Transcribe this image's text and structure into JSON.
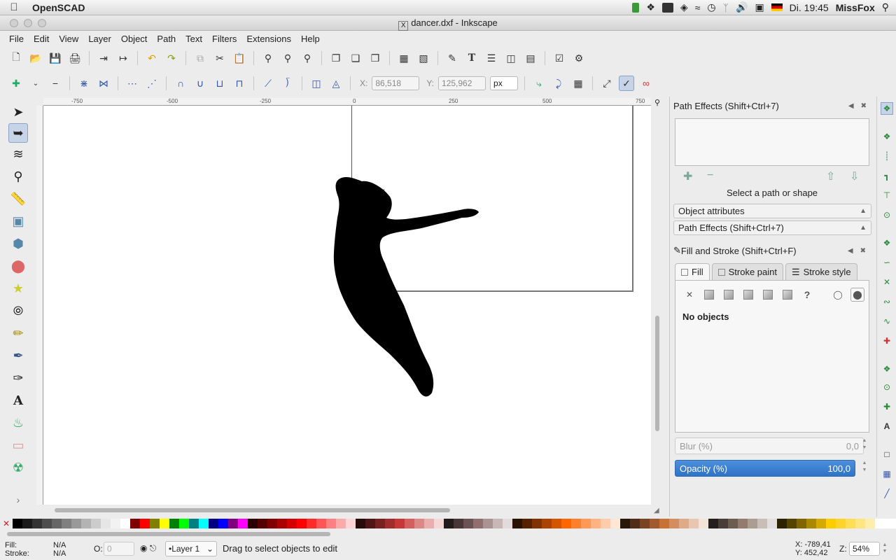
{
  "macbar": {
    "app_name": "OpenSCAD",
    "clock": "Di. 19:45",
    "user": "MissFox"
  },
  "window": {
    "title": "dancer.dxf - Inkscape"
  },
  "menu": [
    "File",
    "Edit",
    "View",
    "Layer",
    "Object",
    "Path",
    "Text",
    "Filters",
    "Extensions",
    "Help"
  ],
  "controls": {
    "x_label": "X:",
    "x_value": "86,518",
    "y_label": "Y:",
    "y_value": "125,962",
    "unit": "px"
  },
  "ruler": {
    "ticks": [
      "-750",
      "-500",
      "-250",
      "0",
      "250",
      "500",
      "750"
    ]
  },
  "dock": {
    "path_effects_title": "Path Effects  (Shift+Ctrl+7)",
    "path_effects_status": "Select a path or shape",
    "object_attributes": "Object attributes",
    "path_effects_collapsed": "Path Effects  (Shift+Ctrl+7)",
    "fill_stroke_title": "Fill and Stroke (Shift+Ctrl+F)",
    "tab_fill": "Fill",
    "tab_stroke_paint": "Stroke paint",
    "tab_stroke_style": "Stroke style",
    "no_objects": "No objects",
    "blur_label": "Blur (%)",
    "blur_value": "0,0",
    "opacity_label": "Opacity (%)",
    "opacity_value": "100,0"
  },
  "status": {
    "fill_label": "Fill:",
    "stroke_label": "Stroke:",
    "fill_value": "N/A",
    "stroke_value": "N/A",
    "o_label": "O:",
    "o_value": "0",
    "layer": "•Layer 1",
    "message": "Drag to select objects to edit",
    "x_coord": "X: -789,41",
    "y_coord": "Y:  452,42",
    "z_label": "Z:",
    "zoom": "54%"
  },
  "palette_colors": [
    "#000000",
    "#1a1a1a",
    "#333333",
    "#4d4d4d",
    "#666666",
    "#808080",
    "#999999",
    "#b3b3b3",
    "#cccccc",
    "#e6e6e6",
    "#f2f2f2",
    "#ffffff",
    "#800000",
    "#ff0000",
    "#808000",
    "#ffff00",
    "#008000",
    "#00ff00",
    "#008080",
    "#00ffff",
    "#000080",
    "#0000ff",
    "#800080",
    "#ff00ff",
    "#2b0000",
    "#550000",
    "#800000",
    "#aa0000",
    "#d40000",
    "#ff0000",
    "#ff2a2a",
    "#ff5555",
    "#ff8080",
    "#ffaaaa",
    "#ffd5d5",
    "#280b0b",
    "#501616",
    "#782121",
    "#a02c2c",
    "#c83737",
    "#d35f5f",
    "#de8787",
    "#e9afaf",
    "#f4d7d7",
    "#241c1c",
    "#483737",
    "#6c5353",
    "#916f6f",
    "#ac9393",
    "#c8b7b7",
    "#e3dbdb",
    "#2b1100",
    "#552200",
    "#803300",
    "#aa4400",
    "#d45500",
    "#ff6600",
    "#ff7f2a",
    "#ff9955",
    "#ffb380",
    "#ffccaa",
    "#ffe6d5",
    "#28170b",
    "#502d16",
    "#784421",
    "#a05a2c",
    "#c87137",
    "#d38d5f",
    "#deaa87",
    "#e9c6af",
    "#f4e3d7",
    "#241f1c",
    "#483e37",
    "#6c5d53",
    "#917c6f",
    "#ac9d93",
    "#c8beb7",
    "#e3dedb",
    "#2b2200",
    "#554400",
    "#806600",
    "#aa8800",
    "#d4aa00",
    "#ffcc00",
    "#ffd42a",
    "#ffdd55",
    "#ffe680",
    "#ffeeaa"
  ]
}
